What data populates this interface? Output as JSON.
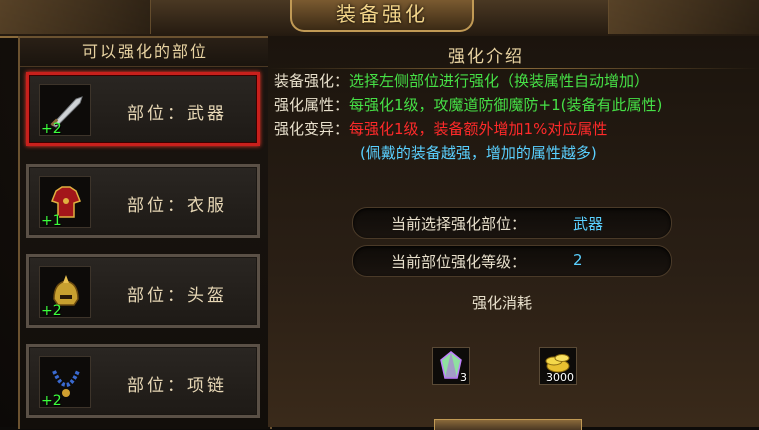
{
  "window": {
    "title": "装备强化"
  },
  "left_panel": {
    "header": "可以强化的部位",
    "slots": [
      {
        "label": "部位：武器",
        "level": "+2",
        "icon": "sword-icon",
        "selected": true
      },
      {
        "label": "部位：衣服",
        "level": "+1",
        "icon": "armor-icon",
        "selected": false
      },
      {
        "label": "部位：头盔",
        "level": "+2",
        "icon": "helmet-icon",
        "selected": false
      },
      {
        "label": "部位：项链",
        "level": "+2",
        "icon": "necklace-icon",
        "selected": false
      }
    ]
  },
  "intro": {
    "header": "强化介绍",
    "lines": [
      {
        "label": "装备强化：",
        "text": "选择左侧部位进行强化（换装属性自动增加）",
        "color": "#46e046"
      },
      {
        "label": "强化属性：",
        "text": "每强化1级，攻魔道防御魔防+1(装备有此属性)",
        "color": "#46e046"
      },
      {
        "label": "强化变异：",
        "text": "每强化1级，装备额外增加1%对应属性",
        "color": "#ff2a2a"
      },
      {
        "label": "",
        "text": "(佩戴的装备越强，增加的属性越多)",
        "color": "#5ad0ff"
      }
    ]
  },
  "status": {
    "selected_part_label": "当前选择强化部位：",
    "selected_part_value": "武器",
    "level_label": "当前部位强化等级：",
    "level_value": "2"
  },
  "cost": {
    "title": "强化消耗",
    "items": [
      {
        "icon": "crystal-icon",
        "qty": "3"
      },
      {
        "icon": "gold-coins-icon",
        "qty": "3000"
      }
    ]
  }
}
